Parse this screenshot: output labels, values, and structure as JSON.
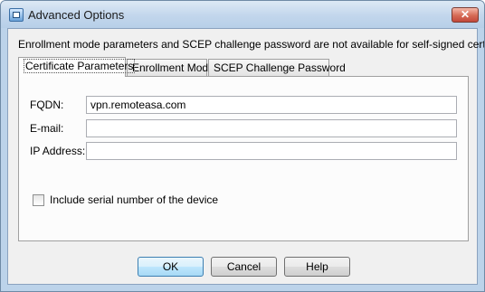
{
  "window": {
    "title": "Advanced Options",
    "close_glyph": "✕"
  },
  "info_text": "Enrollment mode parameters and SCEP challenge password are not available for self-signed certificates.",
  "tabs": [
    {
      "label": "Certificate Parameters",
      "active": true
    },
    {
      "label": "Enrollment Mode",
      "active": false
    },
    {
      "label": "SCEP Challenge Password",
      "active": false
    }
  ],
  "fields": {
    "fqdn": {
      "label": "FQDN:",
      "value": "vpn.remoteasa.com"
    },
    "email": {
      "label": "E-mail:",
      "value": ""
    },
    "ip_address": {
      "label": "IP Address:",
      "value": ""
    }
  },
  "serial_checkbox": {
    "label": "Include serial number of the device",
    "checked": false
  },
  "buttons": {
    "ok": "OK",
    "cancel": "Cancel",
    "help": "Help"
  },
  "colors": {
    "window_frame": "#bcd3ea",
    "client_bg": "#f0f0f0",
    "default_button": "#bee6fd"
  }
}
